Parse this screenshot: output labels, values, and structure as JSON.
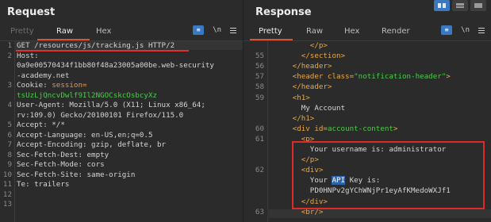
{
  "request": {
    "title": "Request",
    "tabs": [
      "Pretty",
      "Raw",
      "Hex"
    ],
    "active_tab": "Raw",
    "toolbar_icons": [
      "pretty-format-icon",
      "newline-toggle-icon",
      "menu-icon"
    ],
    "newline_label": "\\n",
    "lines": [
      {
        "n": "1",
        "segs": [
          {
            "t": "GET /resources/js/tracking.js HTTP/2",
            "c": "c-plain"
          }
        ]
      },
      {
        "n": "2",
        "segs": [
          {
            "t": "Host:",
            "c": "c-hdr"
          }
        ]
      },
      {
        "n": "",
        "segs": [
          {
            "t": "0a9e00570434f1bb80f48a23005a00be.web-security",
            "c": "c-plain"
          }
        ]
      },
      {
        "n": "",
        "segs": [
          {
            "t": "-academy.net",
            "c": "c-plain"
          }
        ]
      },
      {
        "n": "3",
        "segs": [
          {
            "t": "Cookie: ",
            "c": "c-hdr"
          },
          {
            "t": "session=",
            "c": "c-cookie"
          }
        ]
      },
      {
        "n": "",
        "segs": [
          {
            "t": "tsUzLjQncvDwlf9Il2NGOCskcOsbcyXz",
            "c": "c-green"
          }
        ]
      },
      {
        "n": "4",
        "segs": [
          {
            "t": "User-Agent: Mozilla/5.0 (X11; Linux x86_64;",
            "c": "c-plain"
          }
        ]
      },
      {
        "n": "",
        "segs": [
          {
            "t": "rv:109.0) Gecko/20100101 Firefox/115.0",
            "c": "c-plain"
          }
        ]
      },
      {
        "n": "5",
        "segs": [
          {
            "t": "Accept: */*",
            "c": "c-plain"
          }
        ]
      },
      {
        "n": "6",
        "segs": [
          {
            "t": "Accept-Language: en-US,en;q=0.5",
            "c": "c-plain"
          }
        ]
      },
      {
        "n": "7",
        "segs": [
          {
            "t": "Accept-Encoding: gzip, deflate, br",
            "c": "c-plain"
          }
        ]
      },
      {
        "n": "8",
        "segs": [
          {
            "t": "Sec-Fetch-Dest: empty",
            "c": "c-plain"
          }
        ]
      },
      {
        "n": "9",
        "segs": [
          {
            "t": "Sec-Fetch-Mode: cors",
            "c": "c-plain"
          }
        ]
      },
      {
        "n": "10",
        "segs": [
          {
            "t": "Sec-Fetch-Site: same-origin",
            "c": "c-plain"
          }
        ]
      },
      {
        "n": "11",
        "segs": [
          {
            "t": "Te: trailers",
            "c": "c-plain"
          }
        ]
      },
      {
        "n": "12",
        "segs": []
      },
      {
        "n": "13",
        "segs": []
      }
    ]
  },
  "response": {
    "title": "Response",
    "tabs": [
      "Pretty",
      "Raw",
      "Hex",
      "Render"
    ],
    "active_tab": "Pretty",
    "toolbar_icons": [
      "pretty-format-icon",
      "newline-toggle-icon",
      "menu-icon"
    ],
    "newline_label": "\\n",
    "layout_buttons": [
      "split-horizontal-button",
      "split-vertical-button",
      "single-pane-button"
    ],
    "lines": [
      {
        "n": "",
        "segs": [
          {
            "t": "         </p>",
            "c": "c-tag"
          }
        ]
      },
      {
        "n": "55",
        "segs": [
          {
            "t": "       </section>",
            "c": "c-tag"
          }
        ]
      },
      {
        "n": "56",
        "segs": [
          {
            "t": "     </header>",
            "c": "c-tag"
          }
        ]
      },
      {
        "n": "57",
        "segs": [
          {
            "t": "     <header ",
            "c": "c-tag"
          },
          {
            "t": "class=",
            "c": "c-attr"
          },
          {
            "t": "\"notification-header\"",
            "c": "c-val"
          },
          {
            "t": ">",
            "c": "c-tag"
          }
        ]
      },
      {
        "n": "58",
        "segs": [
          {
            "t": "     </header>",
            "c": "c-tag"
          }
        ]
      },
      {
        "n": "59",
        "segs": [
          {
            "t": "     <h1>",
            "c": "c-tag"
          }
        ]
      },
      {
        "n": "",
        "segs": [
          {
            "t": "       My Account",
            "c": "c-text"
          }
        ]
      },
      {
        "n": "",
        "segs": [
          {
            "t": "     </h1>",
            "c": "c-tag"
          }
        ]
      },
      {
        "n": "60",
        "segs": [
          {
            "t": "     <div ",
            "c": "c-tag"
          },
          {
            "t": "id=",
            "c": "c-attr"
          },
          {
            "t": "account-content",
            "c": "c-val"
          },
          {
            "t": ">",
            "c": "c-tag"
          }
        ]
      },
      {
        "n": "61",
        "segs": [
          {
            "t": "       <p>",
            "c": "c-tag"
          }
        ]
      },
      {
        "n": "",
        "segs": [
          {
            "t": "         Your username is: administrator",
            "c": "c-text"
          }
        ]
      },
      {
        "n": "",
        "segs": [
          {
            "t": "       </p>",
            "c": "c-tag"
          }
        ]
      },
      {
        "n": "62",
        "segs": [
          {
            "t": "       <div>",
            "c": "c-tag"
          }
        ]
      },
      {
        "n": "",
        "segs": [
          {
            "t": "         Your ",
            "c": "c-text"
          },
          {
            "t": "API",
            "c": "c-sel"
          },
          {
            "t": " Key is:",
            "c": "c-text"
          }
        ]
      },
      {
        "n": "",
        "segs": [
          {
            "t": "         PD0HNPv2gYChWNjPr1eyAfKMedoWXJf1",
            "c": "c-text"
          }
        ]
      },
      {
        "n": "",
        "segs": [
          {
            "t": "       </div>",
            "c": "c-tag"
          }
        ]
      },
      {
        "n": "63",
        "segs": [
          {
            "t": "       <br/>",
            "c": "c-tag"
          }
        ]
      }
    ]
  }
}
